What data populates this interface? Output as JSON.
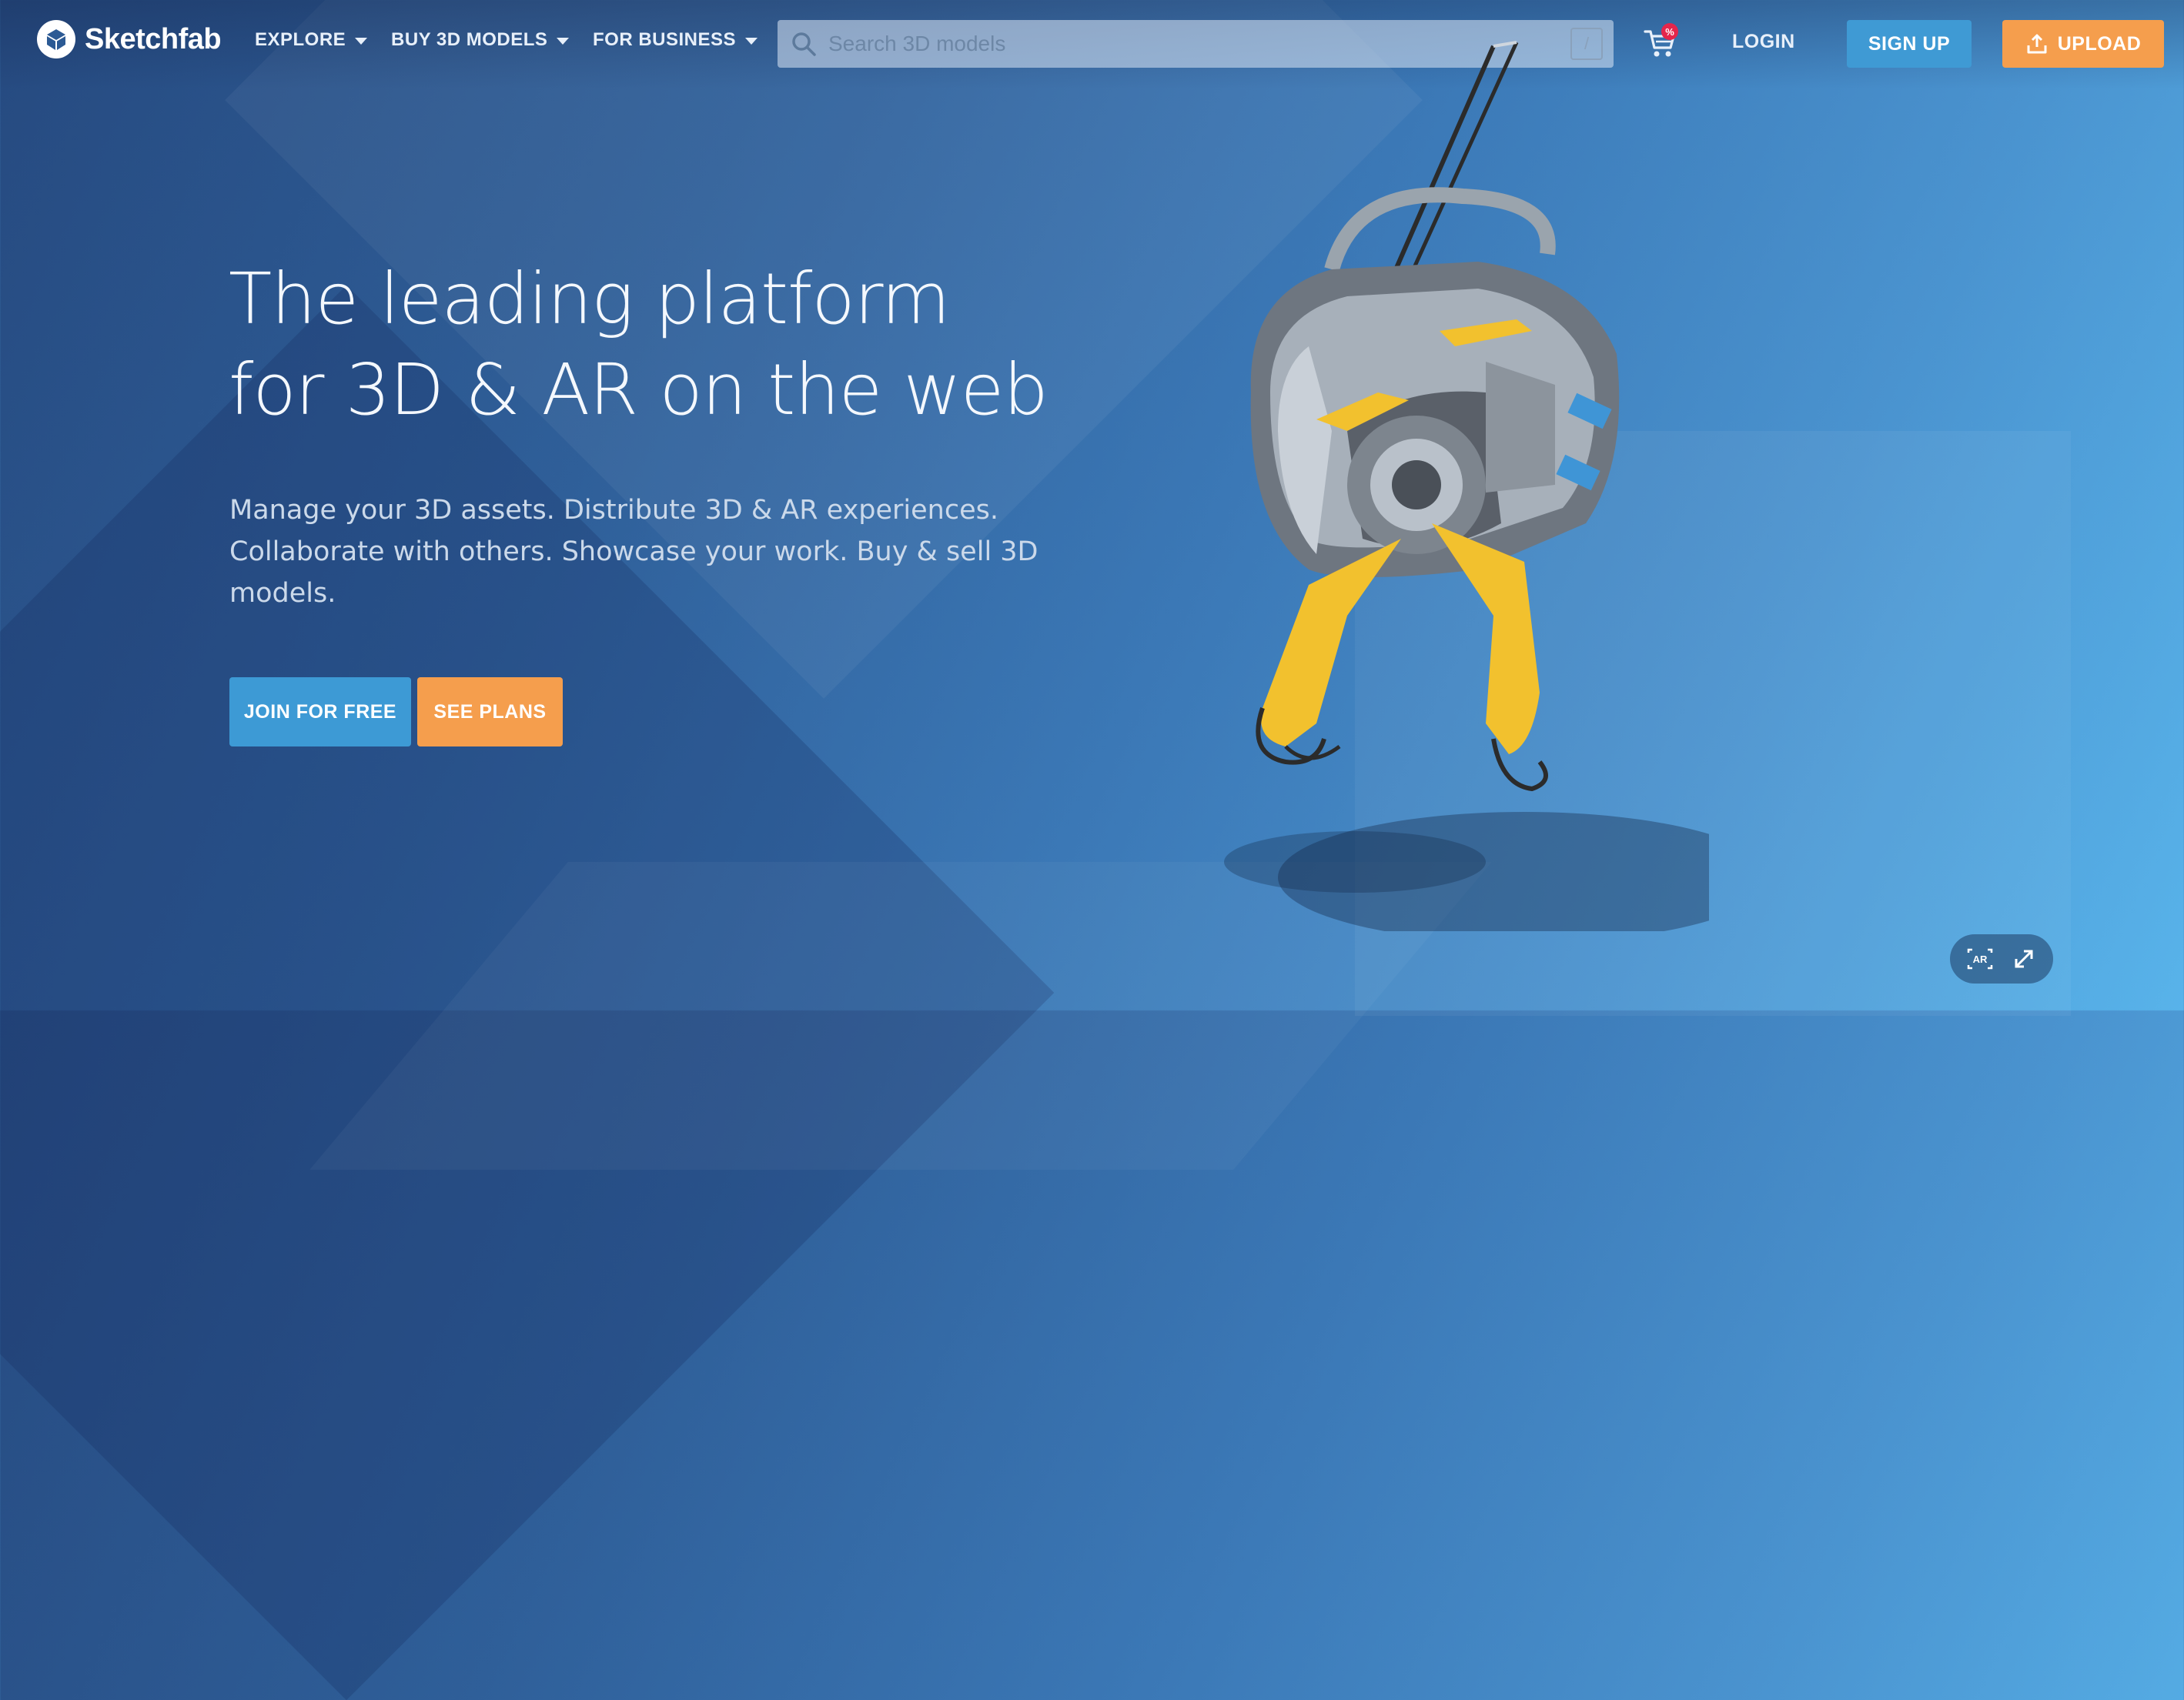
{
  "brand": {
    "name": "Sketchfab"
  },
  "nav": {
    "menus": [
      {
        "label": "EXPLORE"
      },
      {
        "label": "BUY 3D MODELS"
      },
      {
        "label": "FOR BUSINESS"
      }
    ],
    "search_placeholder": "Search 3D models",
    "search_shortcut": "/",
    "cart_badge": "%",
    "login_label": "LOGIN",
    "signup_label": "SIGN UP",
    "upload_label": "UPLOAD"
  },
  "hero": {
    "headline_line1": "The leading platform",
    "headline_line2": "for 3D & AR on the web",
    "subtext": "Manage your 3D assets. Distribute 3D & AR experiences. Collaborate with others. Showcase your work. Buy & sell 3D models.",
    "join_label": "JOIN FOR FREE",
    "plans_label": "SEE PLANS"
  },
  "viewer": {
    "ar_label": "AR"
  },
  "colors": {
    "accent_blue": "#3d9ad5",
    "accent_orange": "#f59e4d",
    "badge_red": "#e4264b",
    "robot_yellow": "#f2c12e"
  }
}
